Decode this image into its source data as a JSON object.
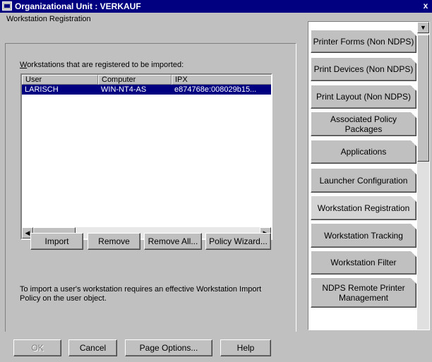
{
  "window": {
    "title": "Organizational Unit : VERKAUF",
    "close_glyph": "x"
  },
  "section_title": "Workstation Registration",
  "list": {
    "label_prefix": "W",
    "label_rest": "orkstations that are registered to be imported:",
    "columns": [
      "User",
      "Computer",
      "IPX"
    ],
    "rows": [
      {
        "user": "LARISCH",
        "computer": "WIN-NT4-AS",
        "ipx": "e874768e:008029b15..."
      }
    ]
  },
  "list_buttons": {
    "import_label": "Import",
    "remove_label": "Remove",
    "remove_all_label": "Remove All...",
    "policy_wizard_label": "Policy Wizard..."
  },
  "note": "To import a user's workstation requires an effective Workstation Import Policy on the user object.",
  "tabs": [
    {
      "label": "Printer Forms (Non NDPS)",
      "active": false
    },
    {
      "label": "Print Devices (Non NDPS)",
      "active": false
    },
    {
      "label": "Print Layout (Non NDPS)",
      "active": false
    },
    {
      "label": "Associated Policy Packages",
      "active": false
    },
    {
      "label": "Applications",
      "active": false
    },
    {
      "label": "Launcher Configuration",
      "active": false
    },
    {
      "label": "Workstation Registration",
      "active": true
    },
    {
      "label": "Workstation Tracking",
      "active": false
    },
    {
      "label": "Workstation Filter",
      "active": false
    },
    {
      "label": "NDPS Remote Printer Management",
      "active": false
    }
  ],
  "dialog_buttons": {
    "ok_label": "OK",
    "cancel_label": "Cancel",
    "page_options_label": "Page Options...",
    "help_label": "Help"
  },
  "colors": {
    "title_bar": "#000080",
    "selection": "#000080",
    "dialog_face": "#c0c0c0"
  }
}
